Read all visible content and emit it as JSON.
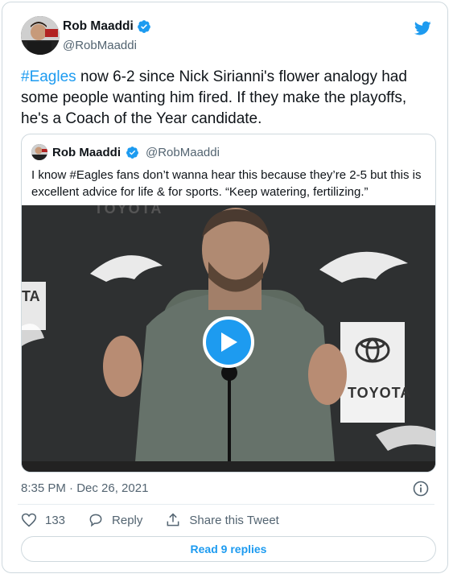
{
  "author": {
    "name": "Rob Maaddi",
    "handle": "@RobMaaddi"
  },
  "tweet": {
    "hashtag": "#Eagles",
    "text_after_hashtag": " now 6-2 since Nick Sirianni's flower analogy had some people wanting him fired. If they make the playoffs, he's a Coach of the Year candidate.",
    "timestamp": "8:35 PM · Dec 26, 2021"
  },
  "quoted": {
    "name": "Rob Maaddi",
    "handle": "@RobMaaddi",
    "text": "I know #Eagles fans don’t wanna hear this because they’re 2-5 but this is excellent advice for life & for sports. “Keep watering, fertilizing.”"
  },
  "video_backdrop": {
    "sponsor_word": "TOYOTA",
    "sponsor_word_partial": "TA",
    "sponsor_word_top": "TOYOTA"
  },
  "actions": {
    "likes": "133",
    "reply_label": "Reply",
    "share_label": "Share this Tweet"
  },
  "read_replies_label": "Read 9 replies",
  "colors": {
    "accent": "#1d9bf0",
    "text": "#0f1419",
    "muted": "#536471",
    "border": "#cfd9de"
  }
}
